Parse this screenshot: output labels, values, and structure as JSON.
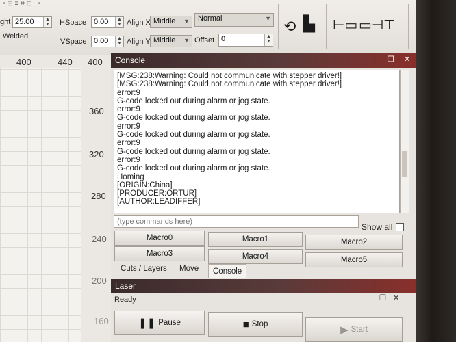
{
  "toolbar": {
    "height_label": "ght",
    "height_value": "25.00",
    "welded_label": "Welded",
    "hspace_label": "HSpace",
    "hspace_value": "0.00",
    "vspace_label": "VSpace",
    "vspace_value": "0.00",
    "align_x_label": "Align X",
    "align_x_value": "Middle",
    "align_y_label": "Align Y",
    "align_y_value": "Middle",
    "style_value": "Normal",
    "offset_label": "Offset",
    "offset_value": "0"
  },
  "ruler": {
    "h_ticks": [
      "400",
      "440",
      "400"
    ],
    "v_ticks": [
      "360",
      "320",
      "280",
      "240",
      "200",
      "160"
    ]
  },
  "console": {
    "title": "Console",
    "log_lines": [
      "[MSG:238:Warning: Could not communicate with stepper driver!]",
      "[MSG:238:Warning: Could not communicate with stepper driver!]",
      "error:9",
      "G-code locked out during alarm or jog state.",
      "error:9",
      "G-code locked out during alarm or jog state.",
      "error:9",
      "G-code locked out during alarm or jog state.",
      "error:9",
      "G-code locked out during alarm or jog state.",
      "error:9",
      "G-code locked out during alarm or jog state.",
      "Homing",
      "[ORIGIN:China]",
      "[PRODUCER:ORTUR]",
      "[AUTHOR:LEADIFFER]"
    ],
    "command_placeholder": "(type commands here)",
    "show_all_label": "Show all",
    "macros": [
      "Macro0",
      "Macro1",
      "Macro2",
      "Macro3",
      "Macro4",
      "Macro5"
    ],
    "tabs": [
      "Cuts / Layers",
      "Move",
      "Console"
    ],
    "active_tab": "Console"
  },
  "laser": {
    "title": "Laser",
    "status": "Ready",
    "pause_label": "Pause",
    "stop_label": "Stop",
    "start_label": "Start"
  },
  "colors": {
    "title_gradient_end": "#8a2f2a",
    "panel_bg": "#e7e3de"
  },
  "icons": [
    "spinner-up-icon",
    "spinner-down-icon",
    "dropdown-arrow-icon",
    "rotate-icon",
    "printer-icon",
    "align-icon",
    "pause-icon",
    "stop-icon",
    "start-icon",
    "float-window-icon",
    "close-icon"
  ]
}
